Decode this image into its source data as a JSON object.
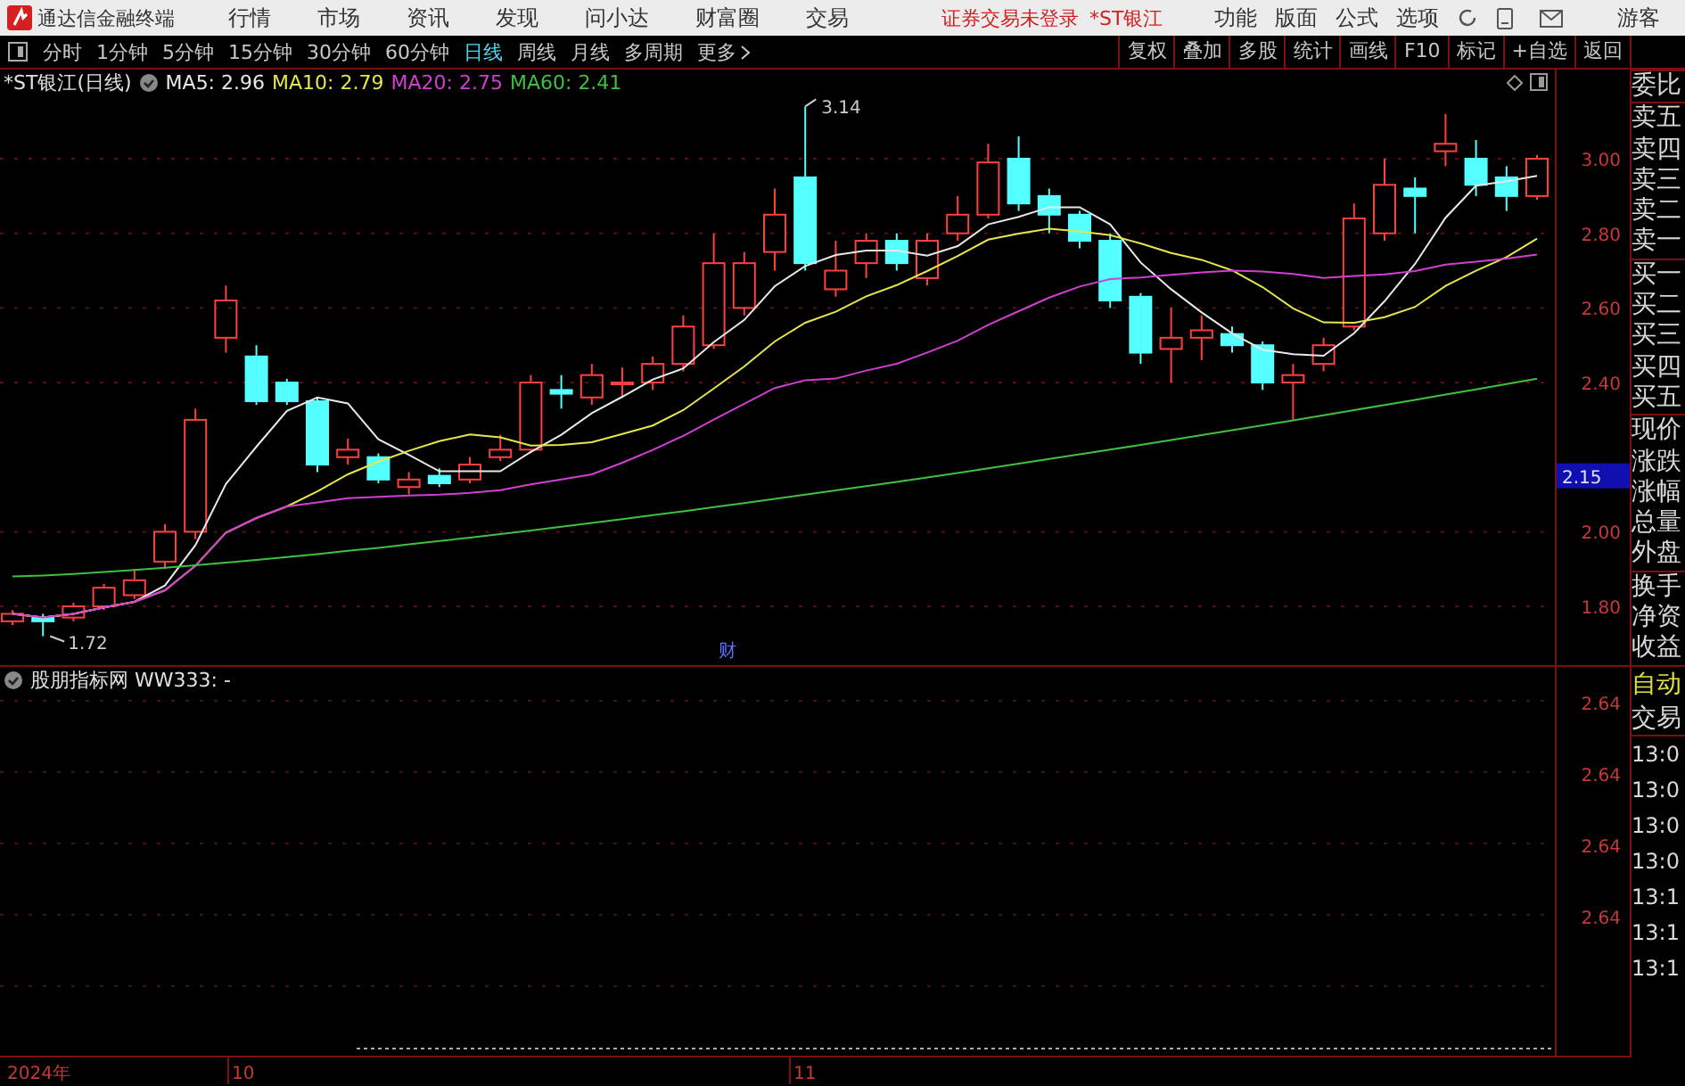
{
  "app": {
    "title": "通达信金融终端"
  },
  "menu": [
    "行情",
    "市场",
    "资讯",
    "发现",
    "问小达",
    "财富圈",
    "交易"
  ],
  "notice": "证券交易未登录",
  "notice_stock": "*ST银江",
  "right_menu": [
    "功能",
    "版面",
    "公式",
    "选项"
  ],
  "user": "游客",
  "periods": [
    {
      "label": "分时",
      "selected": false
    },
    {
      "label": "1分钟",
      "selected": false
    },
    {
      "label": "5分钟",
      "selected": false
    },
    {
      "label": "15分钟",
      "selected": false
    },
    {
      "label": "30分钟",
      "selected": false
    },
    {
      "label": "60分钟",
      "selected": false
    },
    {
      "label": "日线",
      "selected": true
    },
    {
      "label": "周线",
      "selected": false
    },
    {
      "label": "月线",
      "selected": false
    },
    {
      "label": "多周期",
      "selected": false
    },
    {
      "label": "更多",
      "selected": false
    }
  ],
  "tools": [
    "复权",
    "叠加",
    "多股",
    "统计",
    "画线",
    "F10",
    "标记",
    "+自选",
    "返回"
  ],
  "chart": {
    "title": "*ST银江(日线)",
    "ma": [
      {
        "name": "MA5:",
        "value": "2.96",
        "color": "#e8e8e8"
      },
      {
        "name": "MA10:",
        "value": "2.79",
        "color": "#e6e64c"
      },
      {
        "name": "MA20:",
        "value": "2.75",
        "color": "#d040d0"
      },
      {
        "name": "MA60:",
        "value": "2.41",
        "color": "#40c040"
      }
    ],
    "high_label": "3.14",
    "low_label": "1.72",
    "event_marker": "财",
    "y_labels": [
      "3.00",
      "2.80",
      "2.60",
      "2.40",
      "2.00",
      "1.80"
    ],
    "current_price": "2.15"
  },
  "indicator": {
    "title": "股朋指标网 WW333: -",
    "y_labels": [
      "2.64",
      "2.64",
      "2.64",
      "2.64"
    ]
  },
  "quote_panel": {
    "groups": [
      [
        "委比"
      ],
      [
        "卖五",
        "卖四",
        "卖三",
        "卖二",
        "卖一"
      ],
      [
        "买一",
        "买二",
        "买三",
        "买四",
        "买五"
      ],
      [
        "现价",
        "涨跌",
        "涨幅",
        "总量",
        "外盘"
      ],
      [
        "换手",
        "净资",
        "收益"
      ]
    ],
    "auto": "自动",
    "trade": "交易",
    "times": [
      "13:0",
      "13:0",
      "13:0",
      "13:0",
      "13:1",
      "13:1",
      "13:1"
    ]
  },
  "x_axis": [
    "2024年",
    "10",
    "11"
  ]
}
